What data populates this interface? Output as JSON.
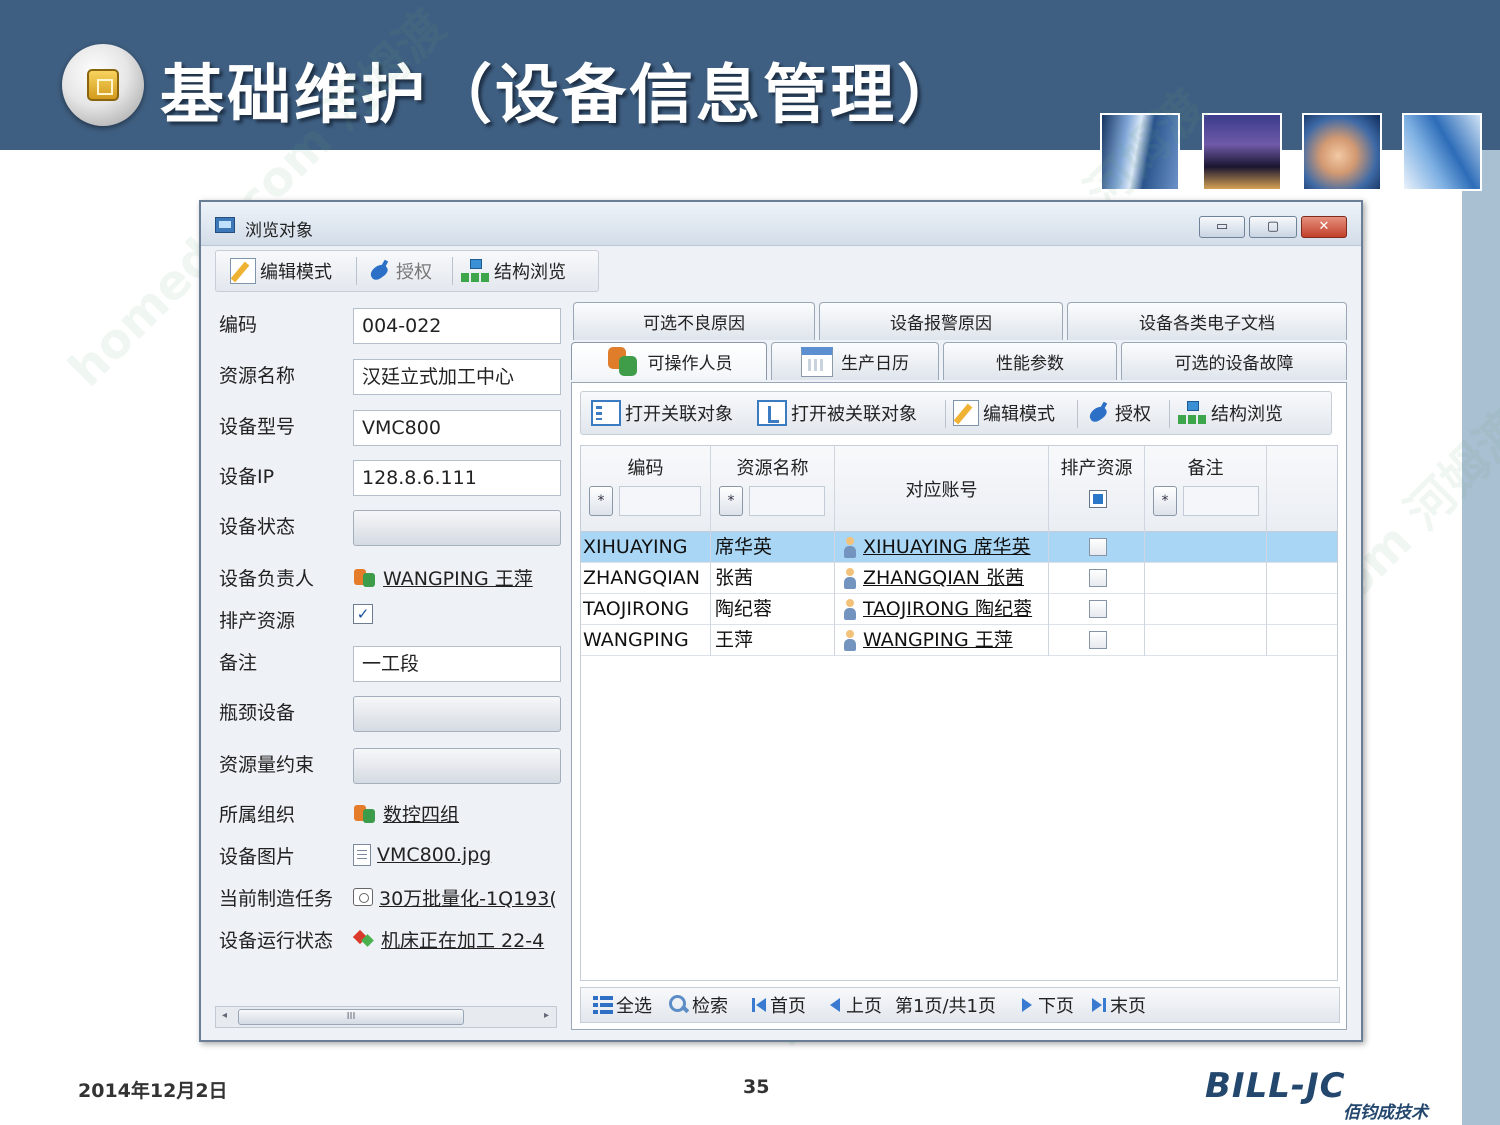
{
  "slide": {
    "title": "基础维护（设备信息管理）",
    "date": "2014年12月2日",
    "page_number": "35",
    "logo_text": "BILL-JC",
    "logo_subtitle": "佰钧成技术",
    "watermark": "homedo.com 河姆渡"
  },
  "window": {
    "title": "浏览对象",
    "minimize": "▭",
    "maximize": "▢",
    "close": "✕",
    "toolbar": {
      "edit_mode": "编辑模式",
      "authorize": "授权",
      "structure_browse": "结构浏览"
    }
  },
  "form": {
    "code": {
      "label": "编码",
      "value": "004-022"
    },
    "resource_name": {
      "label": "资源名称",
      "value": "汉廷立式加工中心"
    },
    "device_model": {
      "label": "设备型号",
      "value": "VMC800"
    },
    "device_ip": {
      "label": "设备IP",
      "value": "128.8.6.111"
    },
    "device_status": {
      "label": "设备状态",
      "value": ""
    },
    "owner": {
      "label": "设备负责人",
      "value": "WANGPING 王萍"
    },
    "scheduling_resource": {
      "label": "排产资源",
      "checked": true,
      "check_glyph": "✓"
    },
    "remark": {
      "label": "备注",
      "value": "一工段"
    },
    "bottleneck": {
      "label": "瓶颈设备",
      "value": ""
    },
    "resource_constraint": {
      "label": "资源量约束",
      "value": ""
    },
    "organization": {
      "label": "所属组织",
      "value": "数控四组"
    },
    "device_image": {
      "label": "设备图片",
      "value": "VMC800.jpg"
    },
    "current_task": {
      "label": "当前制造任务",
      "value": "30万批量化-1Q193("
    },
    "running_state": {
      "label": "设备运行状态",
      "value": "机床正在加工 22-4"
    },
    "scroll_grip": "III",
    "scroll_left": "◂",
    "scroll_right": "▸"
  },
  "tabs": {
    "row1": [
      "可选不良原因",
      "设备报警原因",
      "设备各类电子文档"
    ],
    "row2": [
      "可操作人员",
      "生产日历",
      "性能参数",
      "可选的设备故障"
    ],
    "active": "可操作人员"
  },
  "inner_toolbar": {
    "open_related": "打开关联对象",
    "open_reverse_related": "打开被关联对象",
    "edit_mode": "编辑模式",
    "authorize": "授权",
    "structure_browse": "结构浏览"
  },
  "grid": {
    "columns": {
      "code": "编码",
      "resource_name": "资源名称",
      "account": "对应账号",
      "scheduling": "排产资源",
      "remark": "备注"
    },
    "filter_glyph": "*",
    "rows": [
      {
        "code": "XIHUAYING",
        "name": "席华英",
        "account": "XIHUAYING 席华英",
        "selected": true
      },
      {
        "code": "ZHANGQIAN",
        "name": "张茜",
        "account": "ZHANGQIAN 张茜",
        "selected": false
      },
      {
        "code": "TAOJIRONG",
        "name": "陶纪蓉",
        "account": "TAOJIRONG 陶纪蓉",
        "selected": false
      },
      {
        "code": "WANGPING",
        "name": "王萍",
        "account": "WANGPING 王萍",
        "selected": false
      }
    ]
  },
  "pager": {
    "select_all": "全选",
    "search": "检索",
    "first": "首页",
    "prev": "上页",
    "status": "第1页/共1页",
    "next": "下页",
    "last": "末页"
  }
}
